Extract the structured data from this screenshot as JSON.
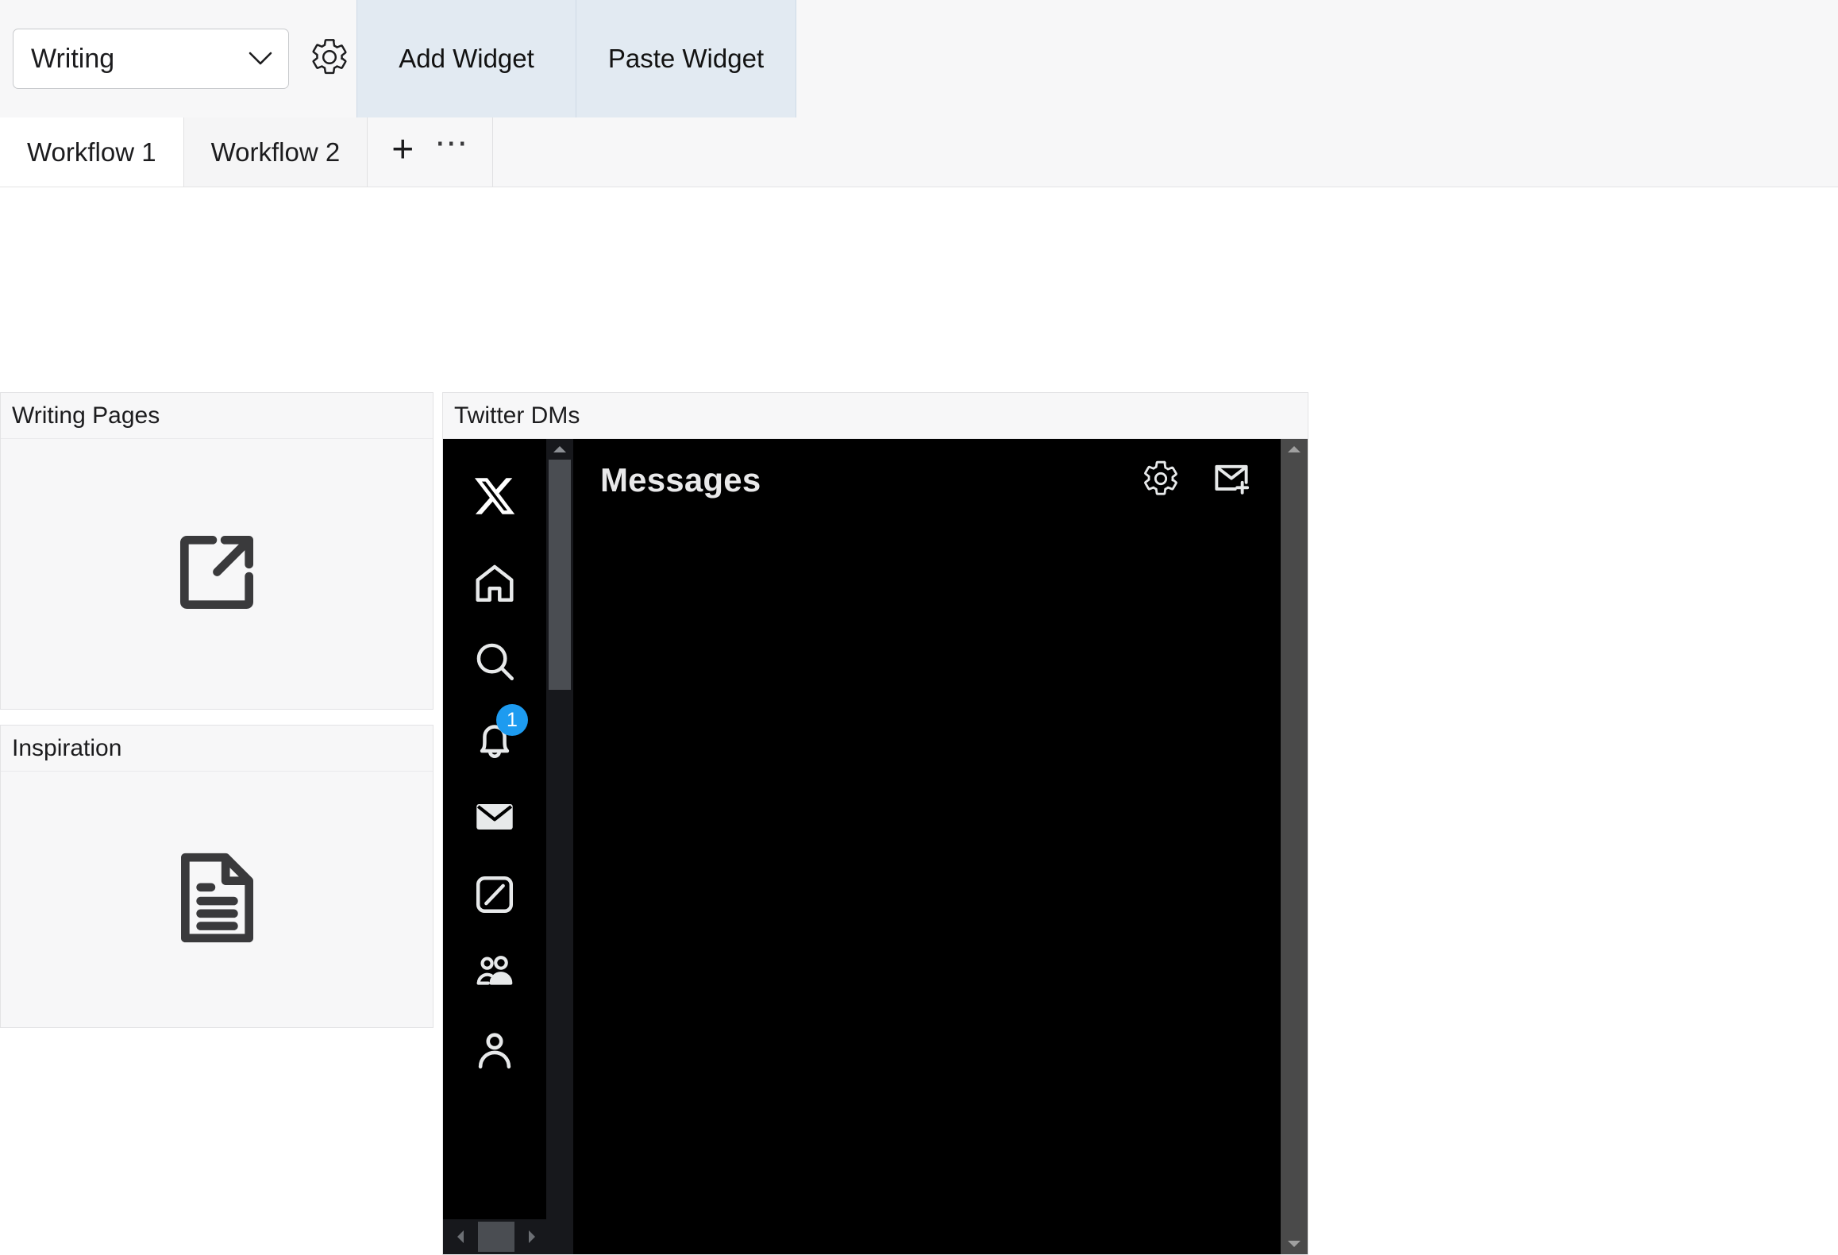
{
  "toolbar": {
    "profile_select": {
      "value": "Writing",
      "icon": "chevron-down-icon"
    },
    "settings_icon": "gear-icon",
    "add_widget_label": "Add Widget",
    "paste_widget_label": "Paste Widget",
    "button_bg": "#e2eaf2"
  },
  "tabbar": {
    "tabs": [
      {
        "label": "Workflow 1",
        "active": true
      },
      {
        "label": "Workflow 2",
        "active": false
      }
    ],
    "add_tab_icon": "plus-icon",
    "more_tab_icon": "ellipsis-icon"
  },
  "widgets": [
    {
      "title": "Writing Pages",
      "placeholder_icon": "external-link-icon"
    },
    {
      "title": "Inspiration",
      "placeholder_icon": "document-icon"
    },
    {
      "title": "Twitter DMs",
      "placeholder_icon": "twitter-dm-embed"
    }
  ],
  "twitter": {
    "logo_icon": "x-logo-icon",
    "nav": [
      {
        "name": "home-icon",
        "label": "Home",
        "badge": null,
        "active": false
      },
      {
        "name": "search-icon",
        "label": "Explore",
        "badge": null,
        "active": false
      },
      {
        "name": "bell-icon",
        "label": "Notifications",
        "badge": "1",
        "active": false
      },
      {
        "name": "envelope-icon",
        "label": "Messages",
        "badge": null,
        "active": true
      },
      {
        "name": "grok-icon",
        "label": "Grok",
        "badge": null,
        "active": false
      },
      {
        "name": "people-icon",
        "label": "Communities",
        "badge": null,
        "active": false
      },
      {
        "name": "person-icon",
        "label": "Profile",
        "badge": null,
        "active": false
      }
    ],
    "messages_title": "Messages",
    "header_icons": [
      {
        "name": "gear-icon",
        "label": "Settings"
      },
      {
        "name": "new-message-icon",
        "label": "New message"
      }
    ],
    "badge_color": "#1d9bf0",
    "background": "#000000"
  }
}
